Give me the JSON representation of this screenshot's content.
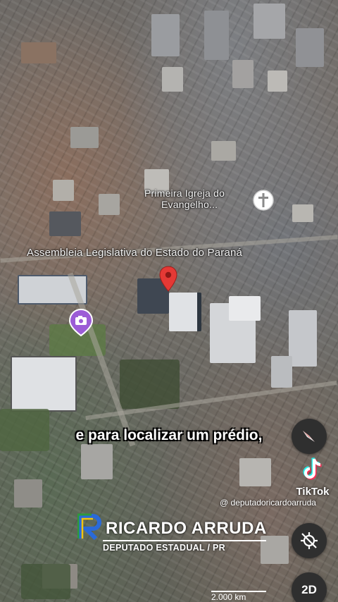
{
  "map": {
    "places": [
      {
        "line1": "Primeira Igreja do",
        "line2": "Evangelho..."
      },
      {
        "name": "Assembleia Legislativa do Estado do Paraná"
      }
    ],
    "scale_label": "2.000 km"
  },
  "caption": "e para localizar um prédio,",
  "controls": {
    "compass_icon": "compass-icon",
    "location_icon": "location-off-icon",
    "view_mode_label": "2D"
  },
  "watermark": {
    "platform": "TikTok",
    "handle": "@ deputadoricardoarruda"
  },
  "branding": {
    "name": "RICARDO ARRUDA",
    "subtitle": "DEPUTADO ESTADUAL / PR"
  },
  "colors": {
    "pin_red": "#e53935",
    "photo_pin_purple": "#9c5cd6",
    "logo_green": "#2e9a3c",
    "logo_yellow": "#f2c40f",
    "logo_blue": "#2a6ad8"
  }
}
